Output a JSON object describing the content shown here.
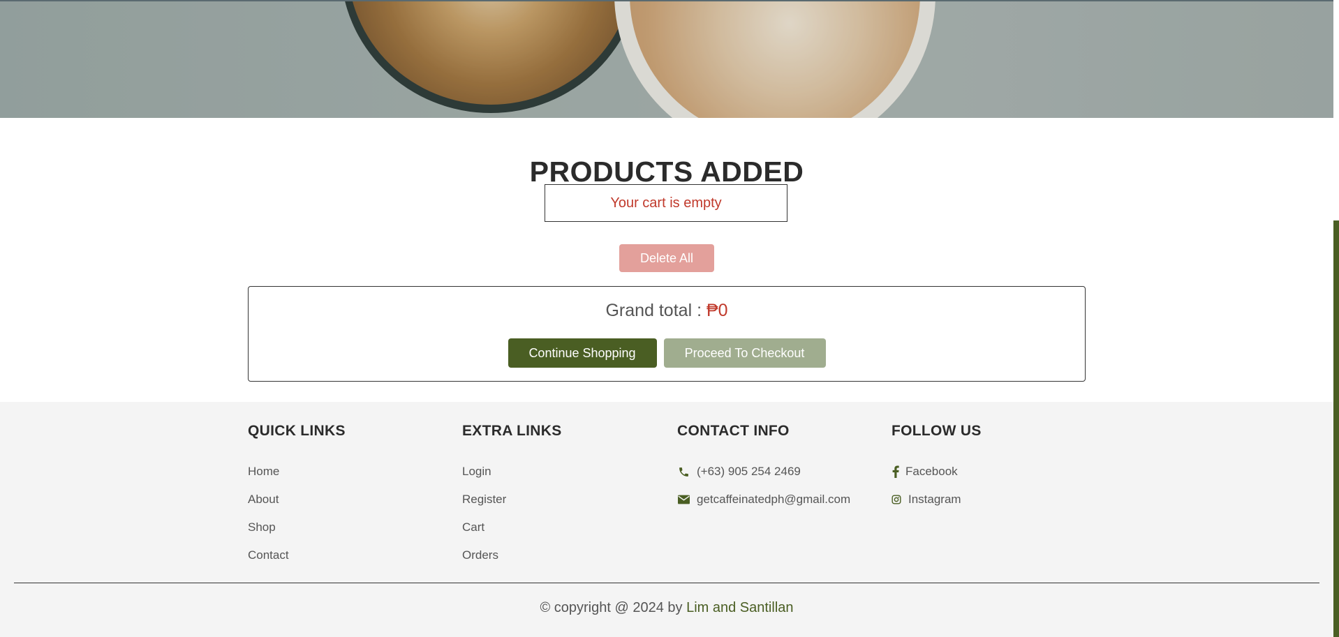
{
  "hero": {
    "image": "latte-art-coffee-cups"
  },
  "cart": {
    "title": "PRODUCTS ADDED",
    "empty_message": "Your cart is empty",
    "delete_all_label": "Delete All",
    "grand_total_label": "Grand total :",
    "grand_total_value": "₱0",
    "continue_label": "Continue Shopping",
    "checkout_label": "Proceed To Checkout"
  },
  "footer": {
    "quick_links": {
      "heading": "QUICK LINKS",
      "items": [
        "Home",
        "About",
        "Shop",
        "Contact"
      ]
    },
    "extra_links": {
      "heading": "EXTRA LINKS",
      "items": [
        "Login",
        "Register",
        "Cart",
        "Orders"
      ]
    },
    "contact_info": {
      "heading": "CONTACT INFO",
      "phone": "(+63) 905 254 2469",
      "email": "getcaffeinatedph@gmail.com"
    },
    "follow_us": {
      "heading": "FOLLOW US",
      "facebook": "Facebook",
      "instagram": "Instagram"
    },
    "credit_prefix": "© copyright @ 2024 by",
    "credit_names": "Lim and Santillan"
  },
  "colors": {
    "accent": "#4a5e23",
    "danger": "#c0392b",
    "delete_button": "#e3a09b",
    "checkout_button": "#a0ad8f",
    "footer_bg": "#f4f4f4"
  },
  "icons": {
    "phone": "phone-icon",
    "email": "envelope-icon",
    "facebook": "facebook-icon",
    "instagram": "instagram-icon"
  }
}
